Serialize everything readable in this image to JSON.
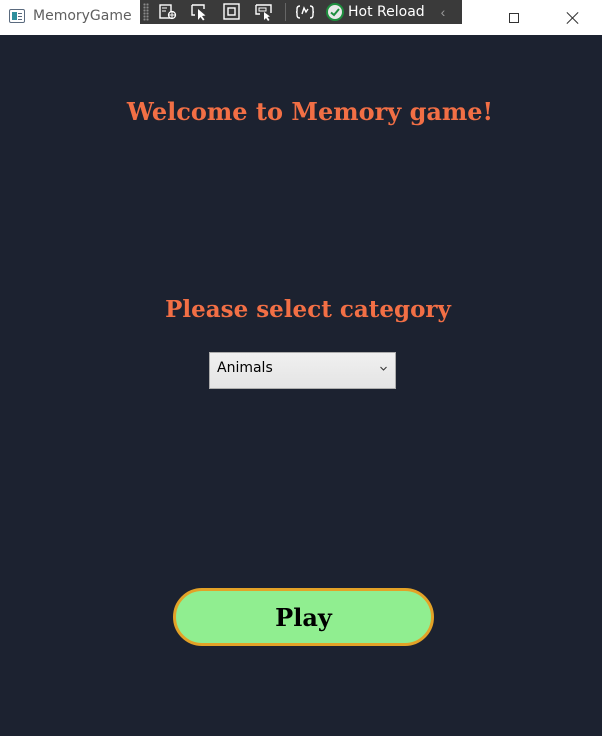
{
  "window": {
    "title": "MemoryGame",
    "hot_reload_label": "Hot Reload",
    "icons": [
      "app-icon",
      "select-element-icon",
      "pointer-icon",
      "frame-icon",
      "track-focus-icon",
      "binding-failures-icon",
      "hot-reload-check-icon",
      "collapse-chevron-icon",
      "maximize-icon",
      "close-icon"
    ]
  },
  "main": {
    "welcome_text": "Welcome to Memory game!",
    "category_prompt": "Please select category",
    "category_select": {
      "selected": "Animals"
    },
    "play_label": "Play"
  },
  "colors": {
    "background": "#1c2230",
    "heading": "#f26f45",
    "play_fill": "#90ee90",
    "play_border": "#e3a227"
  }
}
